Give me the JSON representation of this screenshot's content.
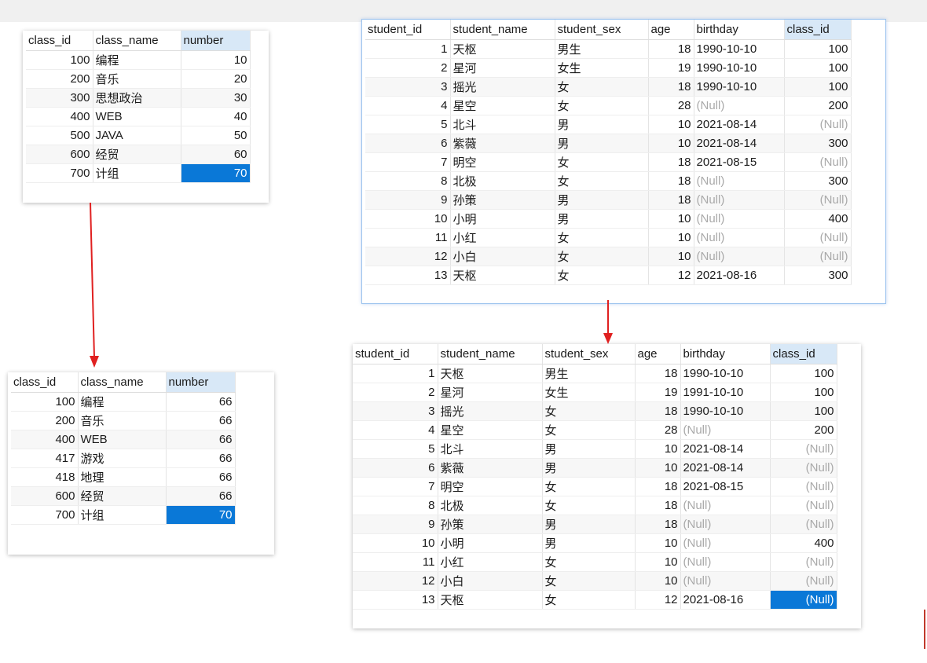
{
  "colors": {
    "accent": "#0a78d7",
    "header_selected": "#d8e8f7",
    "null_text": "#a9a9a9",
    "arrow": "#e02020"
  },
  "class_before": {
    "headers": [
      "class_id",
      "class_name",
      "number"
    ],
    "rows": [
      [
        "100",
        "编程",
        "10"
      ],
      [
        "200",
        "音乐",
        "20"
      ],
      [
        "300",
        "思想政治",
        "30"
      ],
      [
        "400",
        "WEB",
        "40"
      ],
      [
        "500",
        "JAVA",
        "50"
      ],
      [
        "600",
        "经贸",
        "60"
      ],
      [
        "700",
        "计组",
        "70"
      ]
    ]
  },
  "class_after": {
    "headers": [
      "class_id",
      "class_name",
      "number"
    ],
    "rows": [
      [
        "100",
        "编程",
        "66"
      ],
      [
        "200",
        "音乐",
        "66"
      ],
      [
        "400",
        "WEB",
        "66"
      ],
      [
        "417",
        "游戏",
        "66"
      ],
      [
        "418",
        "地理",
        "66"
      ],
      [
        "600",
        "经贸",
        "66"
      ],
      [
        "700",
        "计组",
        "70"
      ]
    ]
  },
  "student_before": {
    "headers": [
      "student_id",
      "student_name",
      "student_sex",
      "age",
      "birthday",
      "class_id"
    ],
    "rows": [
      [
        "1",
        "天枢",
        "男生",
        "18",
        "1990-10-10",
        "100"
      ],
      [
        "2",
        "星河",
        "女生",
        "19",
        "1990-10-10",
        "100"
      ],
      [
        "3",
        "摇光",
        "女",
        "18",
        "1990-10-10",
        "100"
      ],
      [
        "4",
        "星空",
        "女",
        "28",
        "(Null)",
        "200"
      ],
      [
        "5",
        "北斗",
        "男",
        "10",
        "2021-08-14",
        "(Null)"
      ],
      [
        "6",
        "紫薇",
        "男",
        "10",
        "2021-08-14",
        "300"
      ],
      [
        "7",
        "明空",
        "女",
        "18",
        "2021-08-15",
        "(Null)"
      ],
      [
        "8",
        "北极",
        "女",
        "18",
        "(Null)",
        "300"
      ],
      [
        "9",
        "孙策",
        "男",
        "18",
        "(Null)",
        "(Null)"
      ],
      [
        "10",
        "小明",
        "男",
        "10",
        "(Null)",
        "400"
      ],
      [
        "11",
        "小红",
        "女",
        "10",
        "(Null)",
        "(Null)"
      ],
      [
        "12",
        "小白",
        "女",
        "10",
        "(Null)",
        "(Null)"
      ],
      [
        "13",
        "天枢",
        "女",
        "12",
        "2021-08-16",
        "300"
      ]
    ]
  },
  "student_after": {
    "headers": [
      "student_id",
      "student_name",
      "student_sex",
      "age",
      "birthday",
      "class_id"
    ],
    "rows": [
      [
        "1",
        "天枢",
        "男生",
        "18",
        "1990-10-10",
        "100"
      ],
      [
        "2",
        "星河",
        "女生",
        "19",
        "1991-10-10",
        "100"
      ],
      [
        "3",
        "摇光",
        "女",
        "18",
        "1990-10-10",
        "100"
      ],
      [
        "4",
        "星空",
        "女",
        "28",
        "(Null)",
        "200"
      ],
      [
        "5",
        "北斗",
        "男",
        "10",
        "2021-08-14",
        "(Null)"
      ],
      [
        "6",
        "紫薇",
        "男",
        "10",
        "2021-08-14",
        "(Null)"
      ],
      [
        "7",
        "明空",
        "女",
        "18",
        "2021-08-15",
        "(Null)"
      ],
      [
        "8",
        "北极",
        "女",
        "18",
        "(Null)",
        "(Null)"
      ],
      [
        "9",
        "孙策",
        "男",
        "18",
        "(Null)",
        "(Null)"
      ],
      [
        "10",
        "小明",
        "男",
        "10",
        "(Null)",
        "400"
      ],
      [
        "11",
        "小红",
        "女",
        "10",
        "(Null)",
        "(Null)"
      ],
      [
        "12",
        "小白",
        "女",
        "10",
        "(Null)",
        "(Null)"
      ],
      [
        "13",
        "天枢",
        "女",
        "12",
        "2021-08-16",
        "(Null)"
      ]
    ]
  }
}
